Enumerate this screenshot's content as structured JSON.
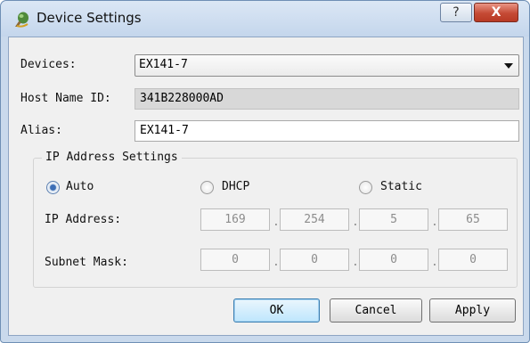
{
  "window": {
    "title": "Device Settings",
    "help_label": "?",
    "close_label": "X"
  },
  "devices": {
    "label": "Devices:",
    "value": "EX141-7"
  },
  "host_name": {
    "label": "Host Name ID:",
    "value": "341B228000AD"
  },
  "alias": {
    "label": "Alias:",
    "value": "EX141-7"
  },
  "ip_settings": {
    "title": "IP Address Settings",
    "modes": [
      {
        "label": "Auto",
        "checked": true
      },
      {
        "label": "DHCP",
        "checked": false
      },
      {
        "label": "Static",
        "checked": false
      }
    ],
    "ip_address": {
      "label": "IP Address:",
      "octets": [
        "169",
        "254",
        "5",
        "65"
      ]
    },
    "subnet_mask": {
      "label": "Subnet Mask:",
      "octets": [
        "0",
        "0",
        "0",
        "0"
      ]
    },
    "separator": "."
  },
  "buttons": {
    "ok": "OK",
    "cancel": "Cancel",
    "apply": "Apply"
  }
}
